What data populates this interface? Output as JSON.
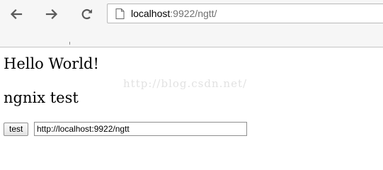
{
  "address_bar": {
    "host": "localhost",
    "rest": ":9922/ngtt/"
  },
  "page": {
    "heading1": "Hello World!",
    "heading2": "ngnix test",
    "watermark": "http://blog.csdn.net/",
    "test_button_label": "test",
    "url_input_value": "http://localhost:9922/ngtt"
  },
  "icons": {
    "back": "arrow-left-icon",
    "forward": "arrow-right-icon",
    "reload": "reload-icon",
    "page": "page-icon"
  },
  "colors": {
    "nav_icon": "#5a5a5a",
    "watermark": "#e2e2e2",
    "url_rest": "#707070"
  }
}
